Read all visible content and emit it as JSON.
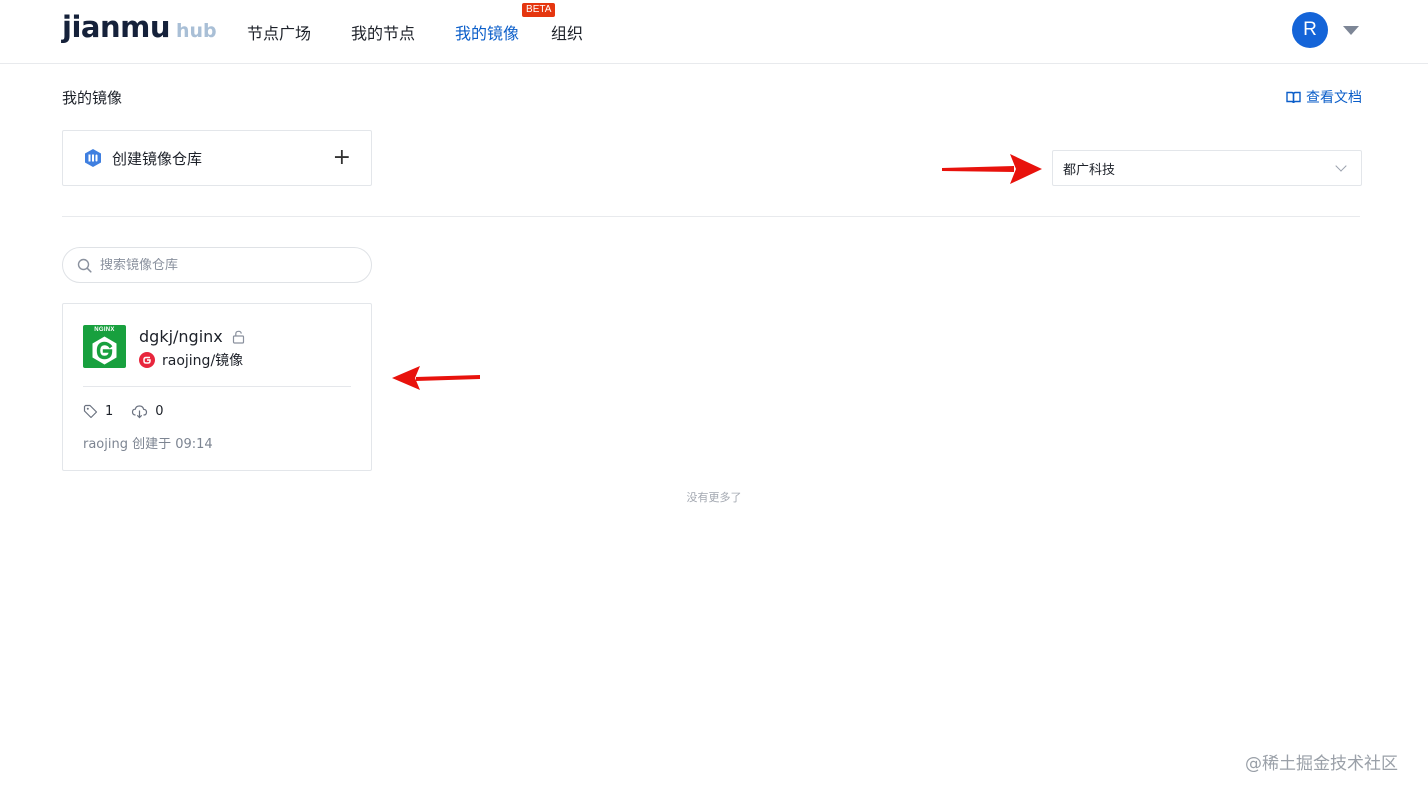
{
  "header": {
    "logo_main": "jianmu",
    "logo_hub": "hub",
    "nav": [
      {
        "label": "节点广场"
      },
      {
        "label": "我的节点"
      },
      {
        "label": "我的镜像",
        "badge": "BETA",
        "active": true
      },
      {
        "label": "组织"
      }
    ],
    "avatar_initial": "R"
  },
  "page": {
    "title": "我的镜像",
    "doc_link": "查看文档"
  },
  "create_repo": {
    "label": "创建镜像仓库",
    "icon": "repo-icon"
  },
  "org_select": {
    "selected": "都广科技"
  },
  "search": {
    "placeholder": "搜索镜像仓库",
    "value": ""
  },
  "repos": [
    {
      "name": "dgkj/nginx",
      "logo_text": "NGINX",
      "owner": "raojing/镜像",
      "tags": "1",
      "pulls": "0",
      "meta": "raojing 创建于 09:14",
      "locked": true
    }
  ],
  "list_footer": "没有更多了",
  "watermark": "@稀土掘金技术社区",
  "colors": {
    "accent": "#0b5ec9",
    "beta_badge": "#e5360f",
    "annotation_arrow": "#e8120c",
    "nginx_green": "#18a03e"
  }
}
